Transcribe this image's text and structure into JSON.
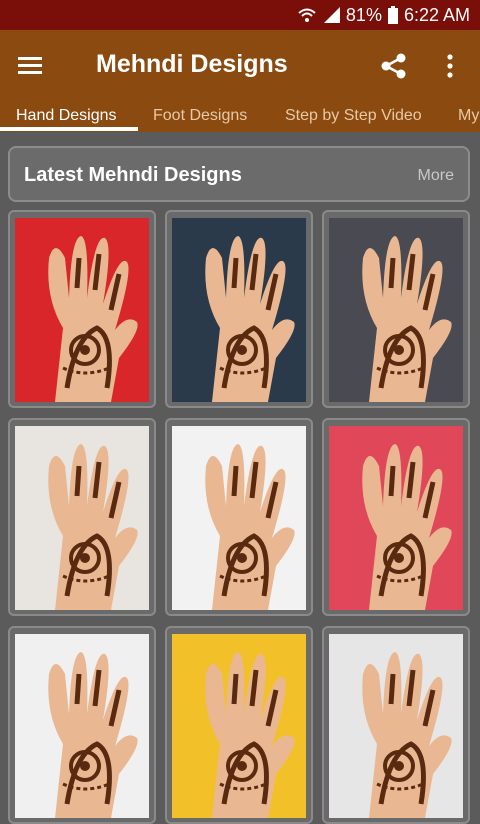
{
  "status": {
    "battery": "81%",
    "time": "6:22 AM"
  },
  "app_bar": {
    "title": "Mehndi Designs"
  },
  "tabs": [
    {
      "label": "Hand Designs"
    },
    {
      "label": "Foot Designs"
    },
    {
      "label": "Step by Step Video"
    },
    {
      "label": "My"
    }
  ],
  "section": {
    "title": "Latest Mehndi Designs",
    "more": "More"
  },
  "colors": {
    "status_bar": "#7a0e08",
    "app_bar": "#8a4a10",
    "background": "#5b5b5b",
    "henna": "#5a2a10"
  },
  "thumbnails": [
    {
      "bg": "#d8262a"
    },
    {
      "bg": "#2a3a4a"
    },
    {
      "bg": "#4a4a52"
    },
    {
      "bg": "#e8e4e0"
    },
    {
      "bg": "#f2f2f2"
    },
    {
      "bg": "#e0485a"
    },
    {
      "bg": "#f0f0f0"
    },
    {
      "bg": "#f2c12a"
    },
    {
      "bg": "#e6e6e6"
    }
  ]
}
